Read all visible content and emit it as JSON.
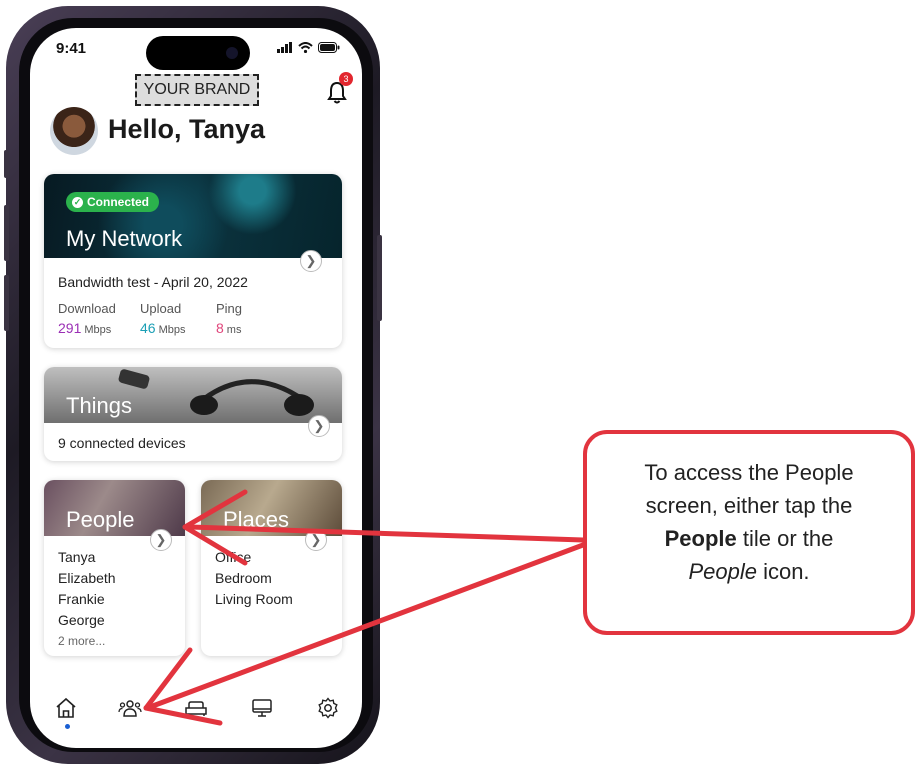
{
  "status": {
    "time": "9:41"
  },
  "brand": {
    "label": "YOUR BRAND"
  },
  "notifications": {
    "count": "3"
  },
  "greeting": "Hello, Tanya",
  "network": {
    "badge": "Connected",
    "title": "My Network",
    "test_label": "Bandwidth test - April 20, 2022",
    "download_label": "Download",
    "download_value": "291",
    "download_unit": "Mbps",
    "upload_label": "Upload",
    "upload_value": "46",
    "upload_unit": "Mbps",
    "ping_label": "Ping",
    "ping_value": "8",
    "ping_unit": "ms",
    "colors": {
      "download": "#9b2fb5",
      "upload": "#1b9fb5",
      "ping": "#e0457b",
      "connected": "#2bb24c"
    }
  },
  "things": {
    "title": "Things",
    "subtitle": "9 connected devices"
  },
  "people": {
    "title": "People",
    "items": [
      "Tanya",
      "Elizabeth",
      "Frankie",
      "George"
    ],
    "more": "2 more..."
  },
  "places": {
    "title": "Places",
    "items": [
      "Office",
      "Bedroom",
      "Living Room"
    ]
  },
  "tabs": [
    "home-icon",
    "people-icon",
    "couch-icon",
    "monitor-icon",
    "settings-icon"
  ],
  "callout": {
    "line1": "To access the People",
    "line2": "screen, either tap the",
    "bold": "People",
    "line3_rest": " tile or the",
    "italic": "People",
    "line4_rest": " icon."
  },
  "accent_color": "#e2343e"
}
